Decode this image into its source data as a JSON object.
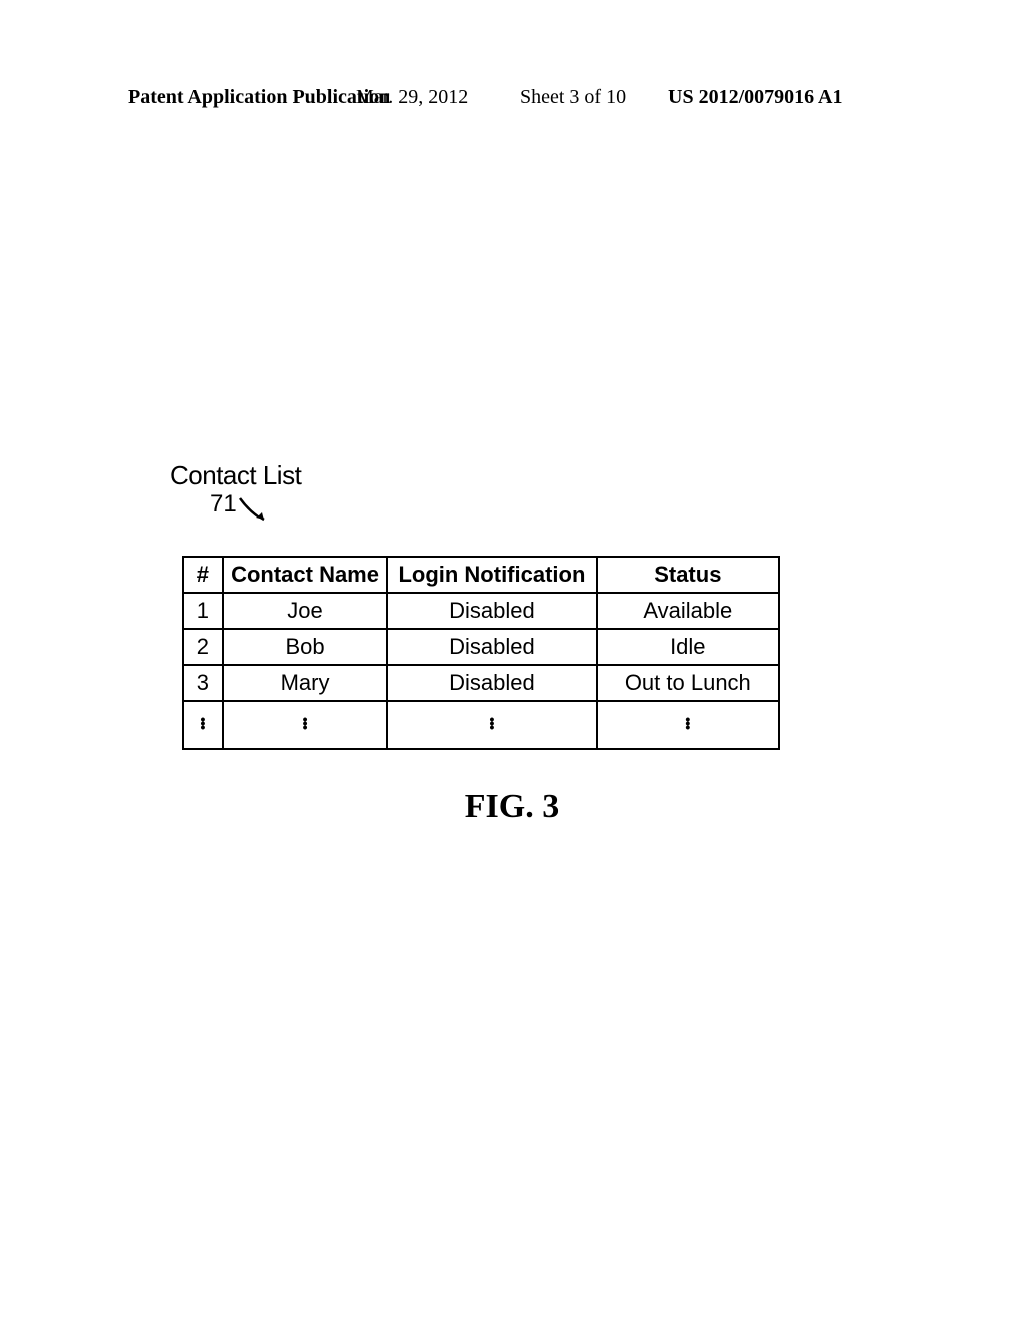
{
  "header": {
    "left": "Patent Application Publication",
    "date": "Mar. 29, 2012",
    "sheet": "Sheet 3 of 10",
    "pubnum": "US 2012/0079016 A1"
  },
  "labels": {
    "contact_list": "Contact List",
    "ref_num": "71"
  },
  "table": {
    "headers": {
      "num": "#",
      "name": "Contact Name",
      "login": "Login Notification",
      "status": "Status"
    },
    "rows": [
      {
        "num": "1",
        "name": "Joe",
        "login": "Disabled",
        "status": "Available"
      },
      {
        "num": "2",
        "name": "Bob",
        "login": "Disabled",
        "status": "Idle"
      },
      {
        "num": "3",
        "name": "Mary",
        "login": "Disabled",
        "status": "Out to Lunch"
      }
    ]
  },
  "figure_caption": "FIG. 3"
}
